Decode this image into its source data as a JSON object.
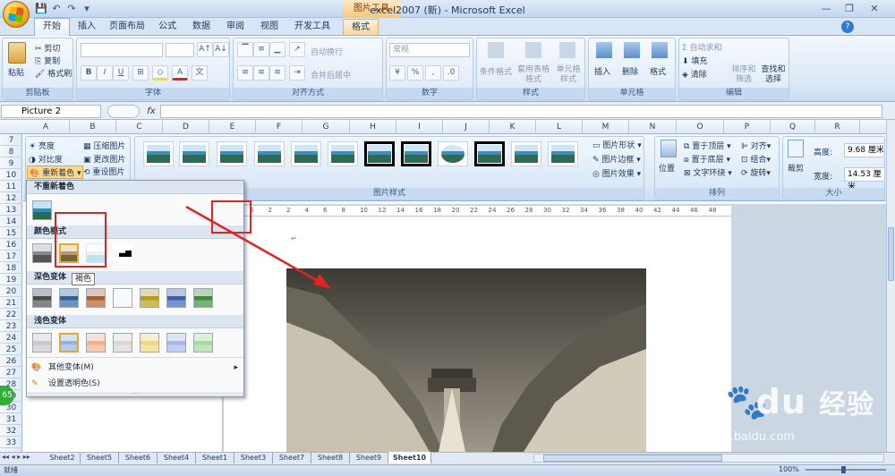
{
  "window": {
    "title": "excel2007 (新) - Microsoft Excel",
    "context_tool": "图片工具",
    "controls": [
      "—",
      "❐",
      "✕"
    ]
  },
  "qat": {
    "save": "💾",
    "undo": "↶",
    "redo": "↷",
    "more": "▾"
  },
  "tabs": [
    {
      "label": "开始",
      "active": true
    },
    {
      "label": "插入"
    },
    {
      "label": "页面布局"
    },
    {
      "label": "公式"
    },
    {
      "label": "数据"
    },
    {
      "label": "审阅"
    },
    {
      "label": "视图"
    },
    {
      "label": "开发工具"
    },
    {
      "label": "格式",
      "context": true
    }
  ],
  "ribbon": {
    "clipboard": {
      "label": "剪贴板",
      "paste": "粘贴",
      "cut": "剪切",
      "copy": "复制",
      "format_painter": "格式刷"
    },
    "font": {
      "label": "字体",
      "bold": "B",
      "italic": "I",
      "underline": "U",
      "grow": "A↑",
      "shrink": "A↓"
    },
    "alignment": {
      "label": "对齐方式",
      "wrap": "自动换行",
      "merge": "合并后居中"
    },
    "number": {
      "label": "数字",
      "format": "常规",
      "percent": "%",
      "comma": ","
    },
    "styles": {
      "label": "样式",
      "conditional": "条件格式",
      "table": "套用表格格式",
      "cell": "单元格样式"
    },
    "cells": {
      "label": "单元格",
      "insert": "插入",
      "delete": "删除",
      "format": "格式"
    },
    "editing": {
      "label": "编辑",
      "autosum": "Σ 自动求和",
      "fill": "填充",
      "clear": "清除",
      "sort": "排序和筛选",
      "find": "查找和选择"
    }
  },
  "formula_bar": {
    "name_box": "Picture 2",
    "fx": "fx",
    "value": ""
  },
  "columns": [
    "A",
    "B",
    "C",
    "D",
    "E",
    "F",
    "G",
    "H",
    "I",
    "J",
    "K",
    "L",
    "M",
    "N",
    "O",
    "P",
    "Q",
    "R"
  ],
  "rows": [
    "7",
    "8",
    "9",
    "10",
    "11",
    "12",
    "13",
    "14",
    "15",
    "16",
    "17",
    "18",
    "19",
    "20",
    "21",
    "22",
    "23",
    "24",
    "25",
    "26",
    "27",
    "28",
    "29",
    "30",
    "31",
    "32",
    "33"
  ],
  "picture_tools": {
    "adjust": {
      "brightness": "亮度",
      "contrast": "对比度",
      "recolor": "重新着色",
      "compress": "压缩图片",
      "change": "更改图片",
      "reset": "重设图片"
    },
    "styles_label": "图片样式",
    "shape": "图片形状",
    "border": "图片边框",
    "effects": "图片效果",
    "arrange": {
      "label": "排列",
      "position": "位置",
      "front": "置于顶层",
      "back": "置于底层",
      "wrap": "文字环绕",
      "align": "对齐",
      "group": "组合",
      "rotate": "旋转"
    },
    "size": {
      "label": "大小",
      "crop": "裁剪",
      "height_label": "高度:",
      "height": "9.68 厘米",
      "width_label": "宽度:",
      "width": "14.53 厘米"
    }
  },
  "recolor_menu": {
    "no_recolor": "不重新着色",
    "color_modes": "颜色模式",
    "dark_variations": "深色变体",
    "light_variations": "浅色变体",
    "more_variations": "其他变体(M)",
    "set_transparent": "设置透明色(S)",
    "tooltip": "褐色"
  },
  "ruler_ticks": [
    "4",
    "2",
    "2",
    "4",
    "6",
    "8",
    "10",
    "12",
    "14",
    "16",
    "18",
    "20",
    "22",
    "24",
    "26",
    "28",
    "30",
    "32",
    "34",
    "36",
    "38",
    "40",
    "42",
    "44",
    "46",
    "48"
  ],
  "sheets": [
    "Sheet2",
    "Sheet5",
    "Sheet6",
    "Sheet4",
    "Sheet1",
    "Sheet3",
    "Sheet7",
    "Sheet8",
    "Sheet9",
    "Sheet10"
  ],
  "active_sheet": "Sheet10",
  "status": {
    "ready": "就绪",
    "zoom": "100%"
  },
  "watermark": {
    "brand": "Bai",
    "brand2": "du",
    "cn": "经验",
    "url": "jingyan.baidu.com"
  },
  "badge": "65",
  "colors": {
    "ribbon_accent": "#8db2e3",
    "highlight": "#e02424",
    "context_tab": "#f6d8a3"
  }
}
